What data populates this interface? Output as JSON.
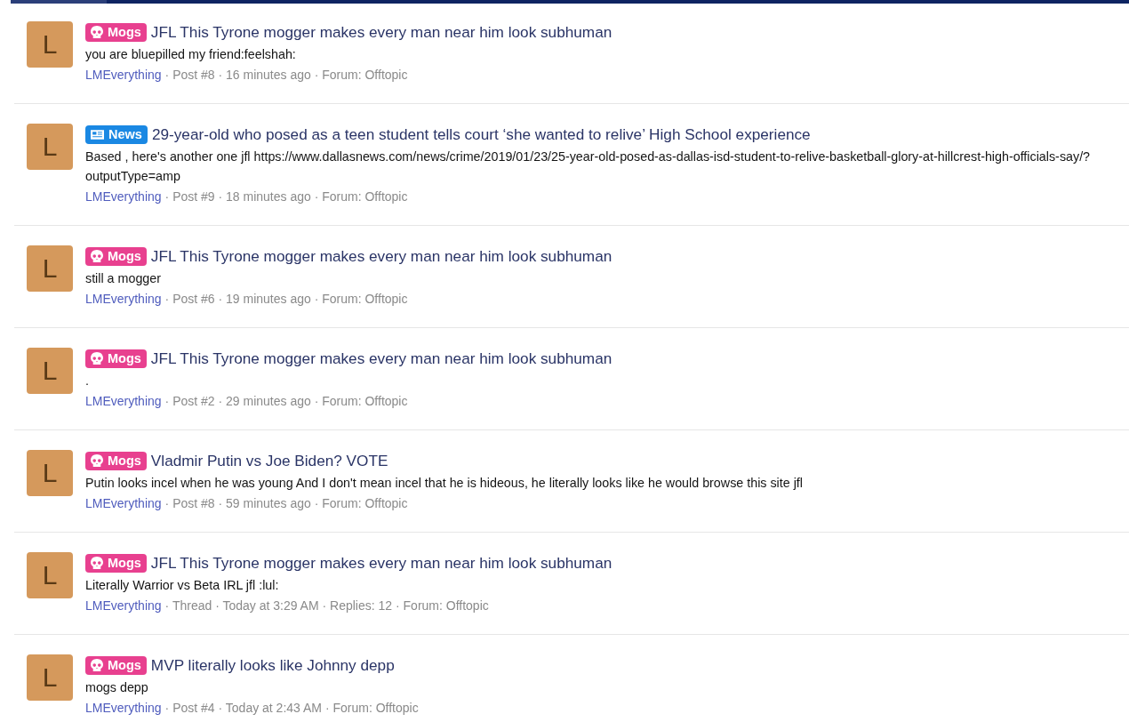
{
  "results": [
    {
      "avatar": "L",
      "prefix": {
        "kind": "skull",
        "label": "Mogs",
        "color": "#e8408f"
      },
      "title": "JFL This Tyrone mogger makes every man near him look subhuman",
      "snippet": "you are bluepilled my friend:feelshah:",
      "author": "LMEverything",
      "meta": "· Post #8 · 16 minutes ago · Forum: Offtopic"
    },
    {
      "avatar": "L",
      "prefix": {
        "kind": "newspaper",
        "label": "News",
        "color": "#1a88e3"
      },
      "title": "29-year-old who posed as a teen student tells court ‘she wanted to relive’ High School experience",
      "snippet": "Based , here's another one jfl https://www.dallasnews.com/news/crime/2019/01/23/25-year-old-posed-as-dallas-isd-student-to-relive-basketball-glory-at-hillcrest-high-officials-say/?outputType=amp",
      "author": "LMEverything",
      "meta": "· Post #9 · 18 minutes ago · Forum: Offtopic"
    },
    {
      "avatar": "L",
      "prefix": {
        "kind": "skull",
        "label": "Mogs",
        "color": "#e8408f"
      },
      "title": "JFL This Tyrone mogger makes every man near him look subhuman",
      "snippet": "still a mogger",
      "author": "LMEverything",
      "meta": "· Post #6 · 19 minutes ago · Forum: Offtopic"
    },
    {
      "avatar": "L",
      "prefix": {
        "kind": "skull",
        "label": "Mogs",
        "color": "#e8408f"
      },
      "title": "JFL This Tyrone mogger makes every man near him look subhuman",
      "snippet": ".",
      "author": "LMEverything",
      "meta": "· Post #2 · 29 minutes ago · Forum: Offtopic"
    },
    {
      "avatar": "L",
      "prefix": {
        "kind": "skull",
        "label": "Mogs",
        "color": "#e8408f"
      },
      "title": "Vladmir Putin vs Joe Biden? VOTE",
      "snippet": "Putin looks incel when he was young And I don't mean incel that he is hideous, he literally looks like he would browse this site jfl",
      "author": "LMEverything",
      "meta": "· Post #8 · 59 minutes ago · Forum: Offtopic"
    },
    {
      "avatar": "L",
      "prefix": {
        "kind": "skull",
        "label": "Mogs",
        "color": "#e8408f"
      },
      "title": "JFL This Tyrone mogger makes every man near him look subhuman",
      "snippet": "Literally Warrior vs Beta IRL jfl :lul:",
      "author": "LMEverything",
      "meta": "· Thread · Today at 3:29 AM · Replies: 12 · Forum: Offtopic"
    },
    {
      "avatar": "L",
      "prefix": {
        "kind": "skull",
        "label": "Mogs",
        "color": "#e8408f"
      },
      "title": "MVP literally looks like Johnny depp",
      "snippet": "mogs depp",
      "author": "LMEverything",
      "meta": "· Post #4 · Today at 2:43 AM · Forum: Offtopic"
    }
  ]
}
